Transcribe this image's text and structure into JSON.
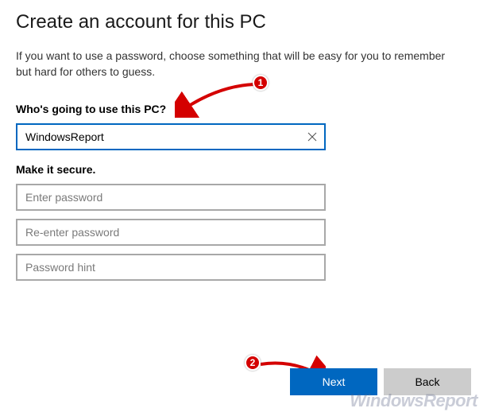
{
  "page": {
    "title": "Create an account for this PC",
    "description": "If you want to use a password, choose something that will be easy for you to remember but hard for others to guess."
  },
  "user_section": {
    "label": "Who's going to use this PC?",
    "username_value": "WindowsReport"
  },
  "secure_section": {
    "label": "Make it secure.",
    "password_placeholder": "Enter password",
    "reenter_placeholder": "Re-enter password",
    "hint_placeholder": "Password hint"
  },
  "buttons": {
    "next": "Next",
    "back": "Back"
  },
  "annotations": {
    "marker1": "1",
    "marker2": "2"
  },
  "watermark": "WindowsReport"
}
